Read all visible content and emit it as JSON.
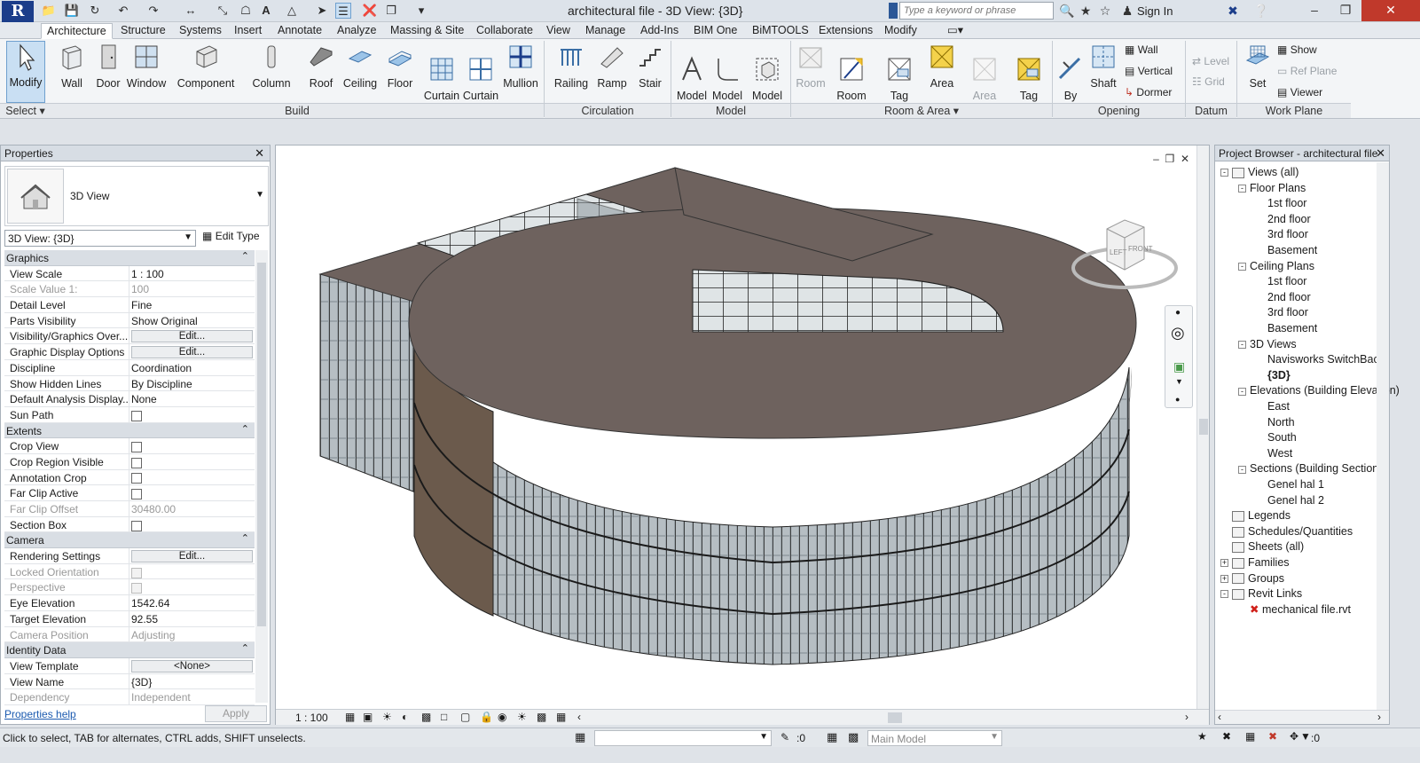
{
  "title_bar": {
    "window_title": "architectural file - 3D View: {3D}",
    "search_placeholder": "Type a keyword or phrase",
    "sign_in": "Sign In",
    "logo_letter": "R"
  },
  "ribbon_tabs": [
    "Architecture",
    "Structure",
    "Systems",
    "Insert",
    "Annotate",
    "Analyze",
    "Massing & Site",
    "Collaborate",
    "View",
    "Manage",
    "Add-Ins",
    "BIM One",
    "BiMTOOLS",
    "Extensions",
    "Modify"
  ],
  "ribbon": {
    "modify": "Modify",
    "build": [
      "Wall",
      "Door",
      "Window",
      "Component",
      "Column",
      "Roof",
      "Ceiling",
      "Floor",
      "Curtain\nSystem",
      "Curtain\nGrid",
      "Mullion"
    ],
    "circulation": [
      "Railing",
      "Ramp",
      "Stair"
    ],
    "model": [
      "Model\nText",
      "Model\nLine",
      "Model\nGroup"
    ],
    "room_area": [
      "Room",
      "Room\nSeparator",
      "Tag\nRoom",
      "Area",
      "Area\nBoundary",
      "Tag\nArea"
    ],
    "opening_large": [
      "By\nFace",
      "Shaft"
    ],
    "opening_small": [
      "Wall",
      "Vertical",
      "Dormer"
    ],
    "datum": [
      "Level",
      "Grid",
      "Ref  Plane"
    ],
    "work_plane_large": "Set",
    "work_plane_small": [
      "Show",
      "Viewer"
    ],
    "groups": [
      "Select",
      "Build",
      "Circulation",
      "Model",
      "Room & Area",
      "Opening",
      "Datum",
      "Work Plane"
    ]
  },
  "properties": {
    "header": "Properties",
    "type_name": "3D View",
    "view_selector": "3D View: {3D}",
    "edit_type": "Edit Type",
    "sections": [
      {
        "name": "Graphics",
        "rows": [
          {
            "k": "View Scale",
            "v": "1 : 100",
            "dim": false,
            "kind": "text"
          },
          {
            "k": "Scale Value    1:",
            "v": "100",
            "dim": true,
            "kind": "text"
          },
          {
            "k": "Detail Level",
            "v": "Fine",
            "dim": false,
            "kind": "text"
          },
          {
            "k": "Parts Visibility",
            "v": "Show Original",
            "dim": false,
            "kind": "text"
          },
          {
            "k": "Visibility/Graphics Over...",
            "v": "Edit...",
            "dim": false,
            "kind": "button"
          },
          {
            "k": "Graphic Display Options",
            "v": "Edit...",
            "dim": false,
            "kind": "button"
          },
          {
            "k": "Discipline",
            "v": "Coordination",
            "dim": false,
            "kind": "text"
          },
          {
            "k": "Show Hidden Lines",
            "v": "By Discipline",
            "dim": false,
            "kind": "text"
          },
          {
            "k": "Default Analysis Display...",
            "v": "None",
            "dim": false,
            "kind": "text"
          },
          {
            "k": "Sun Path",
            "v": "",
            "dim": false,
            "kind": "check"
          }
        ]
      },
      {
        "name": "Extents",
        "rows": [
          {
            "k": "Crop View",
            "v": "",
            "dim": false,
            "kind": "check"
          },
          {
            "k": "Crop Region Visible",
            "v": "",
            "dim": false,
            "kind": "check"
          },
          {
            "k": "Annotation Crop",
            "v": "",
            "dim": false,
            "kind": "check"
          },
          {
            "k": "Far Clip Active",
            "v": "",
            "dim": false,
            "kind": "check"
          },
          {
            "k": "Far Clip Offset",
            "v": "30480.00",
            "dim": true,
            "kind": "text"
          },
          {
            "k": "Section Box",
            "v": "",
            "dim": false,
            "kind": "check"
          }
        ]
      },
      {
        "name": "Camera",
        "rows": [
          {
            "k": "Rendering Settings",
            "v": "Edit...",
            "dim": false,
            "kind": "button"
          },
          {
            "k": "Locked Orientation",
            "v": "",
            "dim": true,
            "kind": "check"
          },
          {
            "k": "Perspective",
            "v": "",
            "dim": true,
            "kind": "check"
          },
          {
            "k": "Eye Elevation",
            "v": "1542.64",
            "dim": false,
            "kind": "text"
          },
          {
            "k": "Target Elevation",
            "v": "92.55",
            "dim": false,
            "kind": "text"
          },
          {
            "k": "Camera Position",
            "v": "Adjusting",
            "dim": true,
            "kind": "text"
          }
        ]
      },
      {
        "name": "Identity Data",
        "rows": [
          {
            "k": "View Template",
            "v": "<None>",
            "dim": false,
            "kind": "button"
          },
          {
            "k": "View Name",
            "v": "{3D}",
            "dim": false,
            "kind": "text"
          },
          {
            "k": "Dependency",
            "v": "Independent",
            "dim": true,
            "kind": "text"
          }
        ]
      }
    ],
    "help_link": "Properties help",
    "apply": "Apply"
  },
  "view": {
    "scale": "1 : 100",
    "viewcube_left": "LEFT",
    "viewcube_front": "FRONT"
  },
  "browser": {
    "header": "Project Browser - architectural file",
    "nodes": [
      {
        "label": "Views (all)",
        "level": 0,
        "toggle": "-",
        "icon": true
      },
      {
        "label": "Floor Plans",
        "level": 1,
        "toggle": "-",
        "icon": false
      },
      {
        "label": "1st floor",
        "level": 2,
        "toggle": "",
        "icon": false
      },
      {
        "label": "2nd floor",
        "level": 2,
        "toggle": "",
        "icon": false
      },
      {
        "label": "3rd floor",
        "level": 2,
        "toggle": "",
        "icon": false
      },
      {
        "label": "Basement",
        "level": 2,
        "toggle": "",
        "icon": false
      },
      {
        "label": "Ceiling Plans",
        "level": 1,
        "toggle": "-",
        "icon": false
      },
      {
        "label": "1st floor",
        "level": 2,
        "toggle": "",
        "icon": false
      },
      {
        "label": "2nd floor",
        "level": 2,
        "toggle": "",
        "icon": false
      },
      {
        "label": "3rd floor",
        "level": 2,
        "toggle": "",
        "icon": false
      },
      {
        "label": "Basement",
        "level": 2,
        "toggle": "",
        "icon": false
      },
      {
        "label": "3D Views",
        "level": 1,
        "toggle": "-",
        "icon": false
      },
      {
        "label": "Navisworks SwitchBack",
        "level": 2,
        "toggle": "",
        "icon": false
      },
      {
        "label": "{3D}",
        "level": 2,
        "toggle": "",
        "icon": false,
        "selected": true
      },
      {
        "label": "Elevations (Building Elevation)",
        "level": 1,
        "toggle": "-",
        "icon": false
      },
      {
        "label": "East",
        "level": 2,
        "toggle": "",
        "icon": false
      },
      {
        "label": "North",
        "level": 2,
        "toggle": "",
        "icon": false
      },
      {
        "label": "South",
        "level": 2,
        "toggle": "",
        "icon": false
      },
      {
        "label": "West",
        "level": 2,
        "toggle": "",
        "icon": false
      },
      {
        "label": "Sections (Building Section)",
        "level": 1,
        "toggle": "-",
        "icon": false
      },
      {
        "label": "Genel hal 1",
        "level": 2,
        "toggle": "",
        "icon": false
      },
      {
        "label": "Genel hal 2",
        "level": 2,
        "toggle": "",
        "icon": false
      },
      {
        "label": "Legends",
        "level": 0,
        "toggle": "",
        "icon": true
      },
      {
        "label": "Schedules/Quantities",
        "level": 0,
        "toggle": "",
        "icon": true
      },
      {
        "label": "Sheets (all)",
        "level": 0,
        "toggle": "",
        "icon": true
      },
      {
        "label": "Families",
        "level": 0,
        "toggle": "+",
        "icon": true
      },
      {
        "label": "Groups",
        "level": 0,
        "toggle": "+",
        "icon": true
      },
      {
        "label": "Revit Links",
        "level": 0,
        "toggle": "-",
        "icon": true
      },
      {
        "label": "mechanical file.rvt",
        "level": 1,
        "toggle": "",
        "icon": false,
        "broken": true
      }
    ]
  },
  "status": {
    "text": "Click to select, TAB for alternates, CTRL adds, SHIFT unselects.",
    "count": ":0",
    "workset": "Main Model",
    "filter": ":0"
  },
  "colors": {
    "accent": "#1b3d8a",
    "roof": "#6e625e",
    "glass": "#8f999f",
    "wall": "#6b5a4c"
  }
}
